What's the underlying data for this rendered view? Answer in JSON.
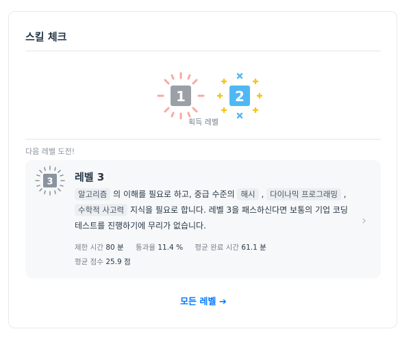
{
  "card": {
    "title": "스킬 체크"
  },
  "badges": {
    "items": [
      {
        "level": "1",
        "color": "#9aa0a6",
        "burst_color": "#f5a9a0"
      },
      {
        "level": "2",
        "color": "#4fb8f4",
        "burst_colors": [
          "#f5c518",
          "#4fb8f4"
        ]
      }
    ],
    "caption": "획득 레벨"
  },
  "next": {
    "caption": "다음 레벨 도전!",
    "level_number": "3",
    "title": "레벨 3",
    "tags": {
      "algorithms": "알고리즘",
      "hash": "해시",
      "dp": "다이나믹 프로그래밍",
      "math": "수학적 사고력"
    },
    "text": {
      "after_algorithms": "의 이해를 필요로 하고, 중급 수준의",
      "comma": ",",
      "after_math": "지식을 필요로 합니다. 레벨 3을 패스하신다면 보통의 기업 코딩 테스트를 진행하기에 무리가 없습니다."
    },
    "stats": {
      "time_label": "제한 시간",
      "time_value": "80 분",
      "pass_label": "통과율",
      "pass_value": "11.4 %",
      "avg_time_label": "평균 완료 시간",
      "avg_time_value": "61.1 분",
      "avg_score_label": "평균 점수",
      "avg_score_value": "25.9 점"
    },
    "chevron": "›"
  },
  "footer": {
    "all_levels": "모든 레벨",
    "arrow": "➔"
  }
}
